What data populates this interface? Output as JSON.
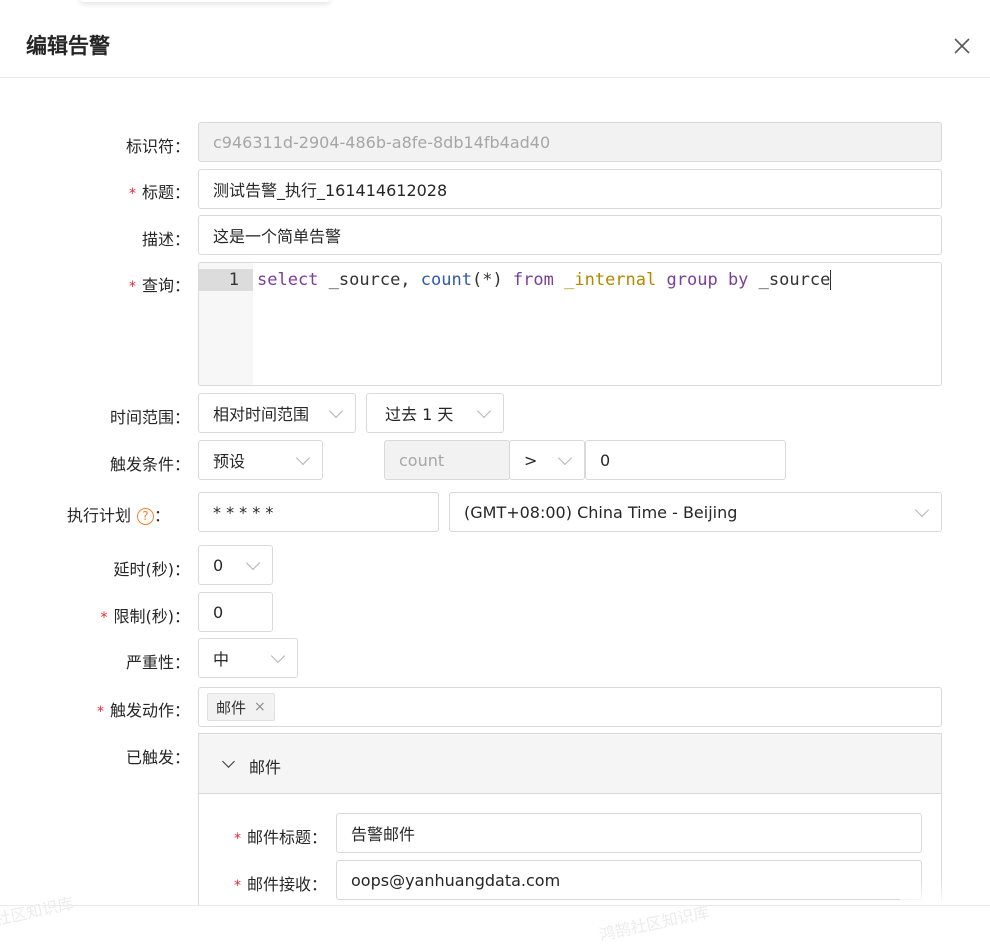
{
  "modal": {
    "title": "编辑告警"
  },
  "form": {
    "identifier": {
      "label": "标识符：",
      "value": "c946311d-2904-486b-a8fe-8db14fb4ad40"
    },
    "title": {
      "label": "标题：",
      "value": "测试告警_执行_161414612028"
    },
    "description": {
      "label": "描述：",
      "value": "这是一个简单告警"
    },
    "query": {
      "label": "查询：",
      "line_number": "1",
      "tokens": {
        "kw_select": "select",
        "t1": " _source, ",
        "fn_count": "count",
        "t2": "(*) ",
        "kw_from": "from",
        "t3": " ",
        "id_internal": "_internal",
        "t4": " ",
        "kw_group": "group",
        "t5": " ",
        "kw_by": "by",
        "t6": " _source"
      }
    },
    "time_range": {
      "label": "时间范围：",
      "mode": "相对时间范围",
      "value": "过去 1 天"
    },
    "trigger_condition": {
      "label": "触发条件：",
      "preset": "预设",
      "field": "count",
      "operator": ">",
      "threshold": "0"
    },
    "schedule": {
      "label": "执行计划",
      "help_glyph": "?",
      "colon": "：",
      "cron": "* * * * *",
      "timezone": "(GMT+08:00) China Time - Beijing"
    },
    "delay": {
      "label": "延时(秒)：",
      "value": "0"
    },
    "limit": {
      "label": "限制(秒)：",
      "value": "0"
    },
    "severity": {
      "label": "严重性：",
      "value": "中"
    },
    "trigger_action": {
      "label": "触发动作：",
      "tag": "邮件",
      "tag_close": "×"
    },
    "triggered": {
      "label": "已触发：",
      "panel_title": "邮件",
      "email_subject": {
        "label": "邮件标题：",
        "value": "告警邮件"
      },
      "email_receiver": {
        "label": "邮件接收：",
        "value": "oops@yanhuangdata.com"
      }
    }
  },
  "required_mark": "*",
  "watermarks": {
    "left": "社区知识库",
    "right": "鸿鹄社区知识库"
  }
}
